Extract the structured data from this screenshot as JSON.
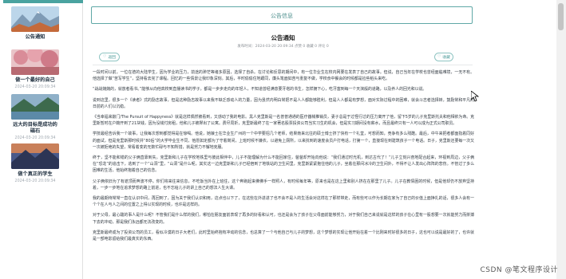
{
  "sidebar": {
    "items": [
      {
        "title": "公告通知",
        "date": "",
        "image": "landscape-mountain"
      },
      {
        "title": "做一个最好的自己",
        "date": "2024-03-20 20:09:34",
        "image": "pink-blossom"
      },
      {
        "title": "远大的目标是成功的磁石",
        "date": "2024-03-20 20:09:34",
        "image": "green-lake"
      },
      {
        "title": "做个真正的学生",
        "date": "2024-03-20 20:09:34",
        "image": "mountain-sunset"
      }
    ]
  },
  "main": {
    "header_title": "公告信息",
    "article_title": "公告通知",
    "meta": "发布时间：2024-03-20 20:09:34    点赞 0    收藏 0    评论 0",
    "back_label": "返回",
    "next_label": "收藏",
    "paragraphs": [
      "一段时间以前，一位在德的大陆学生，因为学业的压力，前途的渺茫等诸多原因，选择了自杀。在讨论和反思的期间中，有一位华业生在校内网要在发表了自己的故事。但说，自己当年在学校也曾经面临难境，一无不有。他选择了做“苦写学生”，坚持看去完了课程。回忆的一些情景让我印象深刻。其后，平时偷偷住地跟同，廉头笔面如苦与重复不做，学校食中餐会的时候都是捡些稻头来吃。",
      "“战战兢兢的，就放者看书。”能够从向他高校到直播读书的学子，都是一步步走向的年轻人，不知道曾经满意要牙塔的书生，怎样拥下心，吃牙塞到每一个天演般的道路，以及养人的回光和以说。",
      "说到这里，很多一个《读者》式的励志故事，但是这种励志故事以来我不缺乏感动人的力量，因为虽然内明白常把不是人人都能够胜利，但是人人都是有梦想，面对实际过程中的困难，就会斗志者选择转，鼓励常和平凡的日前的人们以沉稳。",
      "《当幸福来敲门/The Pursuit of Happyness》就是这样偶然被看到，又感动了我的电影。黑人克里斯是一名普普通通的医疗器械推销员，妻子总是于过怪行过的压力离开了他，留下5岁的儿子克里斯托夫和他相依为命。克里斯暂时在户籍开到了21块钱，因为没钱付房租，他和儿子被撵出了公寓。费尽周折，克里斯最终了在一家著名股票投资公司当实习生的机会，但是实习期间没有薪水，而且最终只有一人可以成为正式公司职员。",
      "学技最经告诉我一个故事，让我每次想到都觉得是在惊喝。他说，她娘士在华业生广州的一个中学要招几个老师，结果南来北往的硕士博士挤了快有一个礼堂，可想而知，竞争有多么残酷。最后，中午来把者都面指着同好的面试，但是克里斯那时候并“80后”的大学毕业生不同，他愿如定都为了守着岗间，上班时候不嫌衣，以避免上厕所，以来找到的速度会员户打电话，打第一个，直接现在到建筑孩子一个电话。日子，克里斯还要每一次又一次被拒绝的失望，常看着变的无数忙碌与不知所措，就是努力不懈地克服。",
      "终于，坚不能和错的父子俩直靠到失。克里斯和儿子在学校地铁里与彼此相伴中，儿子不能理解为什么不能回家住，爸爸却开始向他说：“我们通过时光机，到达古代了！”儿子立刻兴奋地配合起来，环视到周边，父子俩在“恐龙”的追击下，逃到了一个“山洞”里，“山洞”是什么呢，其实这一边克里斯和儿子已经宿到了地铁站的卫生间里，克里斯紧紧抱住他的儿子，坐着在那间冰冷的卫生间外，不得不让人发出心阵阵的悲伤。不管过了多么困难的生活，他始终抱着自己的信念。",
      "父子俩依旧为了有遮顶而奔波不停。你们将来往来信息，不吃饭当外在上班住，这个奔跑起来佛佛手一样照人，有时候每年等，原来也是在这上里和别人挤在在那里了儿子。儿子在教情困的时候，但是他却仍不放弃坚持着，一步一步地在追求梦想的路上前进，也不忘给儿子的讲上自己的想法人生大课。",
      "我的最期待常常一直在认识中间，再回到了，因为关于我们认识和用，这点也以下了，在这些在外进进了也不会不是人的生活会对这样在了那样带走，而有些可以作为长期在家为了自己的价值上面挣扎的话，很多人会有一个个在人与人之间的位置之上得以实现的时候，也许是这样的。",
      "对于父母，最心酸的事人是什么呢？不管我们是什么样的我们，哪怕在朋友面前表现了再多的好看和认可，也还是会为了孩子在父母面前能够努力，对于我们自己来说就是这样的孩子在心里有一股想要一次就能努力而拼搏下去的冲动，那是我们永远都无法改变的。",
      "克里斯最终成为了投资公司的员工，看似冷漠的日子大老们，此时里始终抱有冲动的信念，也总算了一个与他自己与儿子的梦想，这个梦想的实现让他开始在着一个比刚来时好很多的日子，这也可以说是最好的了，也许就是一部电影留给我们最真实的东西。"
    ]
  },
  "watermark": "CSDN @笔文程序设计"
}
